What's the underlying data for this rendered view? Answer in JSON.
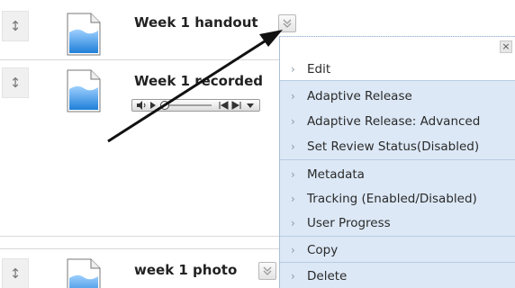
{
  "items": [
    {
      "title": "Week 1 handout"
    },
    {
      "title": "Week 1 recorded"
    },
    {
      "title": "week 1 photo"
    }
  ],
  "context_menu": {
    "close_label": "×",
    "items": [
      {
        "label": "Edit"
      },
      {
        "label": "Adaptive Release"
      },
      {
        "label": "Adaptive Release: Advanced"
      },
      {
        "label": "Set Review Status(Disabled)"
      },
      {
        "label": "Metadata"
      },
      {
        "label": "Tracking (Enabled/Disabled)"
      },
      {
        "label": "User Progress"
      },
      {
        "label": "Copy"
      },
      {
        "label": "Delete"
      }
    ]
  },
  "icons": {
    "drag": "↕",
    "menu_chevron": "chevron-down-icon",
    "item_chevron": "›"
  },
  "colors": {
    "menu_background": "#dce8f6",
    "document_blue": "#2a8de0",
    "annotation_arrow": "#111111"
  }
}
